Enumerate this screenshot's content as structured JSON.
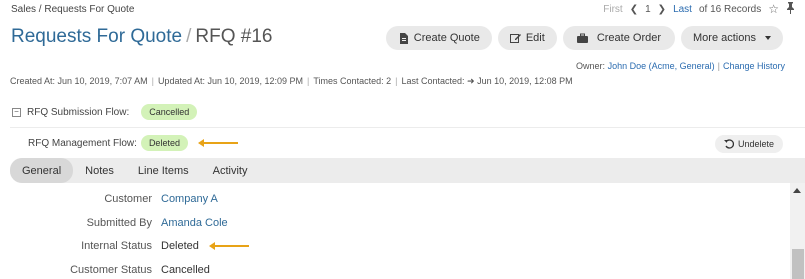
{
  "breadcrumb": "Sales / Requests For Quote",
  "pager": {
    "first": "First",
    "prev_icon": "chevron-left-icon",
    "page": "1",
    "next_icon": "chevron-right-icon",
    "last": "Last",
    "records": "of 16 Records",
    "star_icon": "star-icon",
    "pin_icon": "pin-icon"
  },
  "header": {
    "section": "Requests For Quote",
    "separator": "/",
    "record": "RFQ #16"
  },
  "actions": {
    "create_quote": "Create Quote",
    "edit": "Edit",
    "create_order": "Create Order",
    "more_actions": "More actions"
  },
  "owner": {
    "label": "Owner:",
    "value": "John Doe (Acme, General)",
    "change_history": "Change History"
  },
  "meta": {
    "created": "Created At: Jun 10, 2019, 7:07 AM",
    "updated": "Updated At: Jun 10, 2019, 12:09 PM",
    "times_contacted": "Times Contacted: 2",
    "last_contacted_label": "Last Contacted:",
    "last_contacted_value": "Jun 10, 2019, 12:08 PM"
  },
  "flows": {
    "submission_toggle": "−",
    "submission_label": "RFQ Submission Flow:",
    "submission_status": "Cancelled",
    "management_label": "RFQ Management Flow:",
    "management_status": "Deleted",
    "undelete": "Undelete"
  },
  "tabs": [
    "General",
    "Notes",
    "Line Items",
    "Activity"
  ],
  "fields": [
    {
      "label": "Customer",
      "value": "Company A"
    },
    {
      "label": "Submitted By",
      "value": "Amanda Cole"
    },
    {
      "label": "Internal Status",
      "value": "Deleted"
    },
    {
      "label": "Customer Status",
      "value": "Cancelled"
    }
  ],
  "colors": {
    "link": "#2f6a97",
    "badge_green": "#d3f2b8",
    "annotation_arrow": "#e8a317"
  }
}
